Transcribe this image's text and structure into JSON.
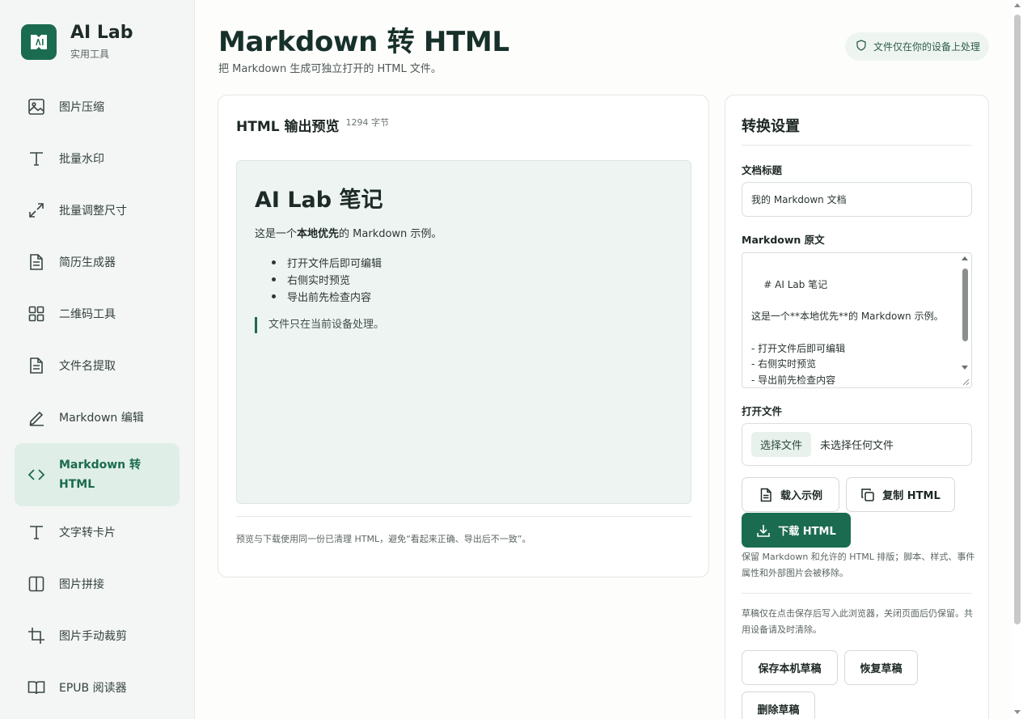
{
  "brand": {
    "name": "AI Lab",
    "subtitle": "实用工具"
  },
  "sidebar": {
    "items": [
      {
        "label": "图片压缩",
        "icon": "image-icon"
      },
      {
        "label": "批量水印",
        "icon": "text-icon"
      },
      {
        "label": "批量调整尺寸",
        "icon": "resize-icon"
      },
      {
        "label": "简历生成器",
        "icon": "document-icon"
      },
      {
        "label": "二维码工具",
        "icon": "grid-icon"
      },
      {
        "label": "文件名提取",
        "icon": "document-icon"
      },
      {
        "label": "Markdown 编辑",
        "icon": "pen-icon"
      },
      {
        "label": "Markdown 转 HTML",
        "icon": "code-icon",
        "active": true
      },
      {
        "label": "文字转卡片",
        "icon": "text-icon"
      },
      {
        "label": "图片拼接",
        "icon": "split-panel-icon"
      },
      {
        "label": "图片手动裁剪",
        "icon": "crop-icon"
      },
      {
        "label": "EPUB 阅读器",
        "icon": "book-icon"
      }
    ]
  },
  "header": {
    "title": "Markdown 转 HTML",
    "subtitle": "把 Markdown 生成可独立打开的 HTML 文件。",
    "privacy_badge": "文件仅在你的设备上处理"
  },
  "preview": {
    "title": "HTML 输出预览",
    "bytes": "1294 字节",
    "heading": "AI Lab 笔记",
    "para_before": "这是一个",
    "para_bold": "本地优先",
    "para_after": "的 Markdown 示例。",
    "list": [
      "打开文件后即可编辑",
      "右侧实时预览",
      "导出前先检查内容"
    ],
    "quote": "文件只在当前设备处理。",
    "note": "预览与下载使用同一份已清理 HTML，避免“看起来正确、导出后不一致”。"
  },
  "settings": {
    "title": "转换设置",
    "doc_title_label": "文档标题",
    "doc_title_value": "我的 Markdown 文档",
    "source_label": "Markdown 原文",
    "source_value": "# AI Lab 笔记\n\n这是一个**本地优先**的 Markdown 示例。\n\n- 打开文件后即可编辑\n- 右侧实时预览\n- 导出前先检查内容",
    "open_file_label": "打开文件",
    "choose_file_button": "选择文件",
    "file_status": "未选择任何文件",
    "load_example_button": "载入示例",
    "copy_html_button": "复制 HTML",
    "download_html_button": "下载 HTML",
    "sanitize_hint": "保留 Markdown 和允许的 HTML 排版；脚本、样式、事件属性和外部图片会被移除。",
    "draft_hint": "草稿仅在点击保存后写入此浏览器，关闭页面后仍保留。共用设备请及时清除。",
    "save_draft_button": "保存本机草稿",
    "restore_draft_button": "恢复草稿",
    "delete_draft_button": "删除草稿"
  },
  "colors": {
    "accent": "#1b6b50",
    "sidebar_bg": "#f3f6f4",
    "active_bg": "#dfeee7",
    "preview_bg": "#eef4f1"
  }
}
